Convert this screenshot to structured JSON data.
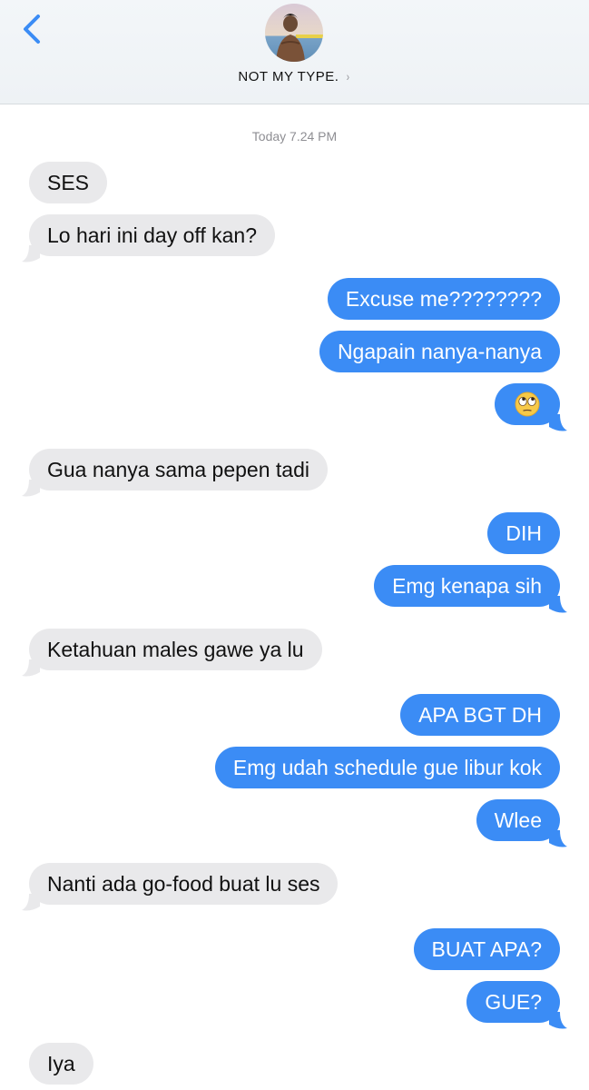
{
  "header": {
    "contact_name": "NOT MY TYPE.",
    "chevron": "›",
    "back_icon": "chevron-left-icon",
    "accent": "#3b8cf5"
  },
  "timestamp": "Today 7.24 PM",
  "colors": {
    "incoming_bubble": "#e9e9eb",
    "outgoing_bubble": "#3b8cf5"
  },
  "messages": [
    {
      "from": "them",
      "text": "SES"
    },
    {
      "from": "them",
      "text": "Lo hari ini day off kan?"
    },
    {
      "from": "me",
      "text": "Excuse me????????"
    },
    {
      "from": "me",
      "text": "Ngapain nanya-nanya"
    },
    {
      "from": "me",
      "text": "",
      "emoji": "eye-roll-emoji"
    },
    {
      "from": "them",
      "text": "Gua nanya sama pepen tadi"
    },
    {
      "from": "me",
      "text": "DIH"
    },
    {
      "from": "me",
      "text": "Emg kenapa sih"
    },
    {
      "from": "them",
      "text": "Ketahuan males gawe ya lu"
    },
    {
      "from": "me",
      "text": "APA BGT DH"
    },
    {
      "from": "me",
      "text": "Emg udah schedule gue libur kok"
    },
    {
      "from": "me",
      "text": "Wlee"
    },
    {
      "from": "them",
      "text": "Nanti ada go-food buat lu ses"
    },
    {
      "from": "me",
      "text": "BUAT APA?"
    },
    {
      "from": "me",
      "text": "GUE?"
    },
    {
      "from": "them",
      "text": "Iya"
    }
  ]
}
